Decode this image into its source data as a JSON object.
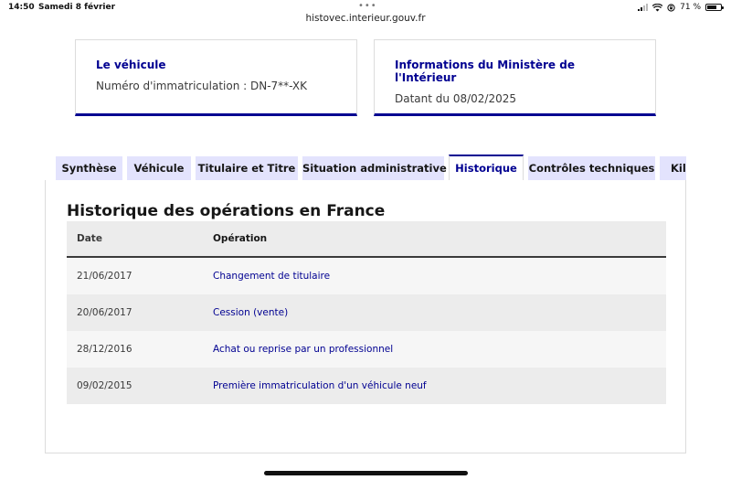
{
  "status_bar": {
    "time": "14:50",
    "date": "Samedi 8 février",
    "battery": "71 %",
    "icons": [
      "signal-icon",
      "wifi-icon",
      "orientation-lock-icon",
      "battery-icon"
    ]
  },
  "browser": {
    "url": "histovec.interieur.gouv.fr"
  },
  "cards": {
    "vehicle": {
      "title": "Le véhicule",
      "text": "Numéro d'immatriculation : DN-7**-XK"
    },
    "ministry": {
      "title": "Informations du Ministère de l'Intérieur",
      "text": "Datant du 08/02/2025"
    }
  },
  "tabs": [
    {
      "label": "Synthèse",
      "active": false
    },
    {
      "label": "Véhicule",
      "active": false
    },
    {
      "label": "Titulaire et Titre",
      "active": false
    },
    {
      "label": "Situation administrative",
      "active": false
    },
    {
      "label": "Historique",
      "active": true
    },
    {
      "label": "Contrôles techniques",
      "active": false
    },
    {
      "label": "Kil",
      "active": false
    }
  ],
  "history": {
    "title": "Historique des opérations en France",
    "columns": {
      "date": "Date",
      "operation": "Opération"
    },
    "rows": [
      {
        "date": "21/06/2017",
        "operation": "Changement de titulaire"
      },
      {
        "date": "20/06/2017",
        "operation": "Cession (vente)"
      },
      {
        "date": "28/12/2016",
        "operation": "Achat ou reprise par un professionnel"
      },
      {
        "date": "09/02/2015",
        "operation": "Première immatriculation d'un véhicule neuf"
      }
    ]
  },
  "colors": {
    "accent": "#000091",
    "tab_background": "#e3e3fd",
    "header_background": "#ececec"
  }
}
